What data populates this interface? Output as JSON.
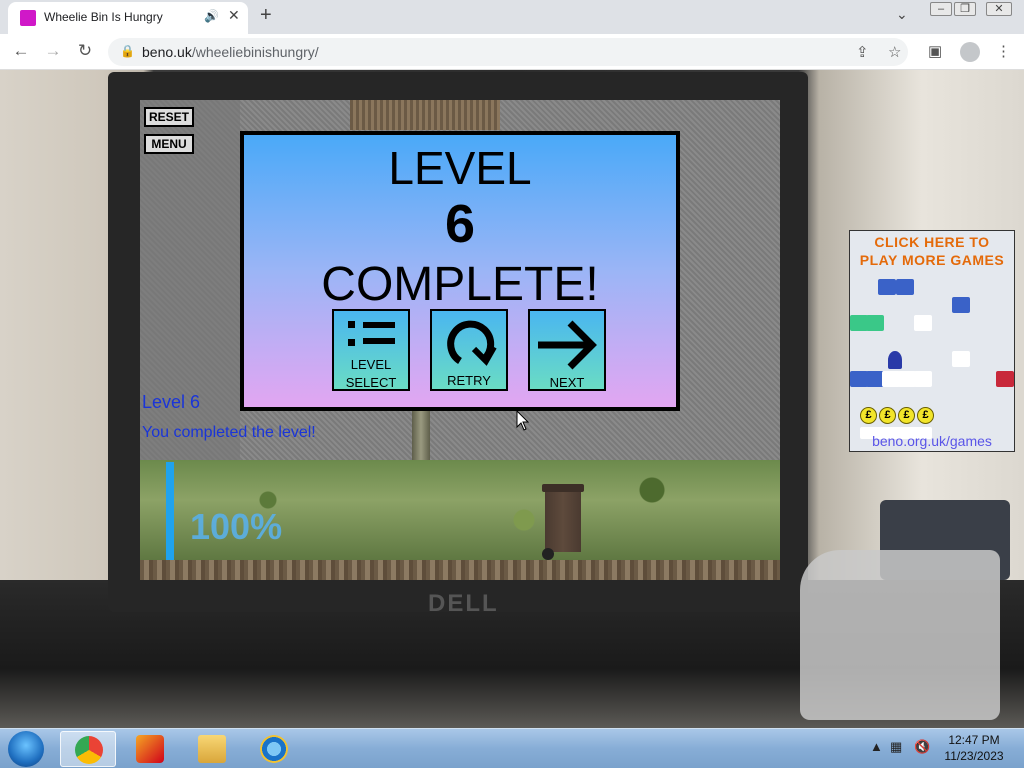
{
  "browser": {
    "tab_title": "Wheelie Bin Is Hungry",
    "url_domain": "beno.uk",
    "url_path": "/wheeliebinishungry/",
    "new_tab_glyph": "+",
    "close_glyph": "✕"
  },
  "game": {
    "reset_label": "RESET",
    "menu_label": "MENU",
    "level_label": "Level 6",
    "level_message": "You completed the level!",
    "progress_text": "100%",
    "progress_value": 1.0,
    "panel": {
      "line1": "LEVEL",
      "number": "6",
      "line3": "COMPLETE!",
      "buttons": [
        {
          "label_line1": "LEVEL",
          "label_line2": "SELECT",
          "icon": "list-icon"
        },
        {
          "label_line1": "RETRY",
          "icon": "retry-icon"
        },
        {
          "label_line1": "NEXT",
          "icon": "arrow-right-icon"
        }
      ]
    }
  },
  "ad": {
    "title_line1": "CLICK HERE TO",
    "title_line2": "PLAY MORE GAMES",
    "url": "beno.org.uk/games",
    "coin_symbol": "£"
  },
  "taskbar": {
    "time": "12:47 PM",
    "date": "11/23/2023"
  },
  "colors": {
    "panel_top": "#4aa9f8",
    "panel_bottom": "#e2a6f2",
    "level_text": "#1a35d8",
    "progress": "#1fa3ee",
    "ad_title": "#e46a0a",
    "ad_url": "#5a55e8"
  }
}
